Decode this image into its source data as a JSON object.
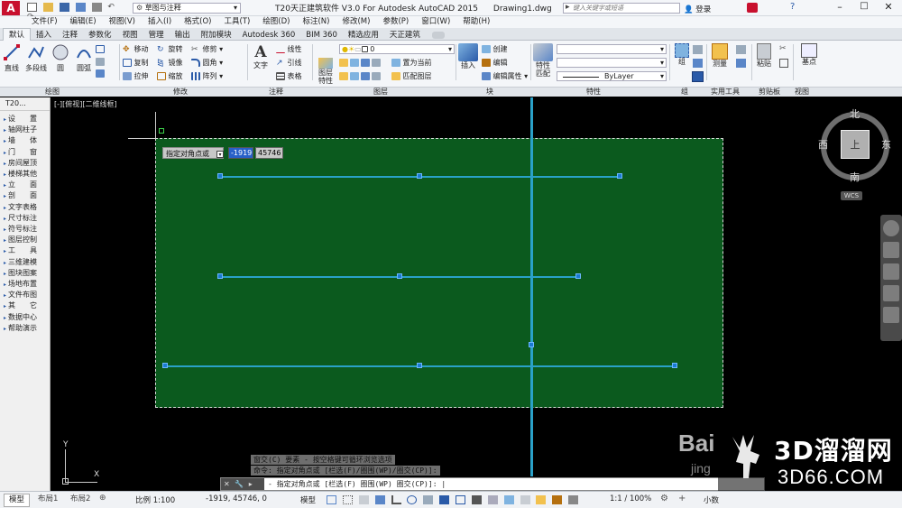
{
  "app": {
    "title": "T20天正建筑软件 V3.0 For Autodesk AutoCAD 2015",
    "filename": "Drawing1.dwg",
    "workspace": "草图与注释",
    "search_placeholder": "键入关键字或短语",
    "login_label": "登录"
  },
  "menu": [
    "文件(F)",
    "编辑(E)",
    "视图(V)",
    "插入(I)",
    "格式(O)",
    "工具(T)",
    "绘图(D)",
    "标注(N)",
    "修改(M)",
    "参数(P)",
    "窗口(W)",
    "帮助(H)"
  ],
  "tabs": [
    "默认",
    "插入",
    "注释",
    "参数化",
    "视图",
    "管理",
    "输出",
    "附加模块",
    "Autodesk 360",
    "BIM 360",
    "精选应用",
    "天正建筑"
  ],
  "ribbon": {
    "draw": {
      "line": "直线",
      "polyline": "多段线",
      "circle": "圆",
      "arc": "圆弧"
    },
    "modify": {
      "move": "移动",
      "rotate": "旋转",
      "trim": "修剪",
      "copy": "复制",
      "mirror": "镜像",
      "fillet": "圆角",
      "stretch": "拉伸",
      "scale": "缩放",
      "array": "阵列"
    },
    "annotation": {
      "text": "文字",
      "linear": "线性",
      "leader": "引线",
      "table": "表格"
    },
    "layers": {
      "layer_props": "图层\n特性",
      "layer_name": "0",
      "set_current": "置为当前",
      "match_layer": "匹配图层"
    },
    "block": {
      "insert": "插入",
      "create": "创建",
      "edit": "编辑",
      "edit_attr": "编辑属性"
    },
    "properties": {
      "match": "特性\n匹配",
      "bylayer": "ByLayer"
    },
    "groups": {
      "group": "组"
    },
    "utilities": {
      "measure": "测量"
    },
    "clipboard": {
      "paste": "粘贴"
    },
    "view": {
      "base": "基点"
    },
    "panel_titles": [
      "绘图",
      "修改",
      "注释",
      "图层",
      "块",
      "特性",
      "组",
      "实用工具",
      "剪贴板",
      "视图"
    ]
  },
  "tool_palette": {
    "title": "T20...",
    "items": [
      "设　　置",
      "轴网柱子",
      "墙　　体",
      "门　　窗",
      "房间屋顶",
      "楼梯其他",
      "立　　面",
      "剖　　面",
      "文字表格",
      "尺寸标注",
      "符号标注",
      "图层控制",
      "工　　具",
      "三维建模",
      "图块图案",
      "场地布置",
      "文件布图",
      "其　　它",
      "数据中心",
      "帮助演示"
    ]
  },
  "viewport": {
    "label": "[-][俯视][二维线框]",
    "dyn_prompt": "指定对角点或",
    "dyn_x": "-1919",
    "dyn_y": "45746",
    "compass": {
      "north": "北",
      "south": "南",
      "east": "东",
      "west": "西",
      "top": "上",
      "wcs": "WCS"
    },
    "ucs": {
      "x": "X",
      "y": "Y"
    }
  },
  "command": {
    "history1": "窗交(C) 要素 - 按空格键可循环浏览选项",
    "history2": "命令: 指定对角点或 [栏选(F)/圈围(WP)/圈交(CP)]:",
    "prompt": "- 指定对角点或 [栏选(F) 圈围(WP) 圈交(CP)]: |"
  },
  "status": {
    "tabs": [
      "模型",
      "布局1",
      "布局2"
    ],
    "scale": "比例 1:100",
    "coords": "-1919, 45746, 0",
    "model_label": "模型",
    "anno_scale": "1:1 / 100%",
    "decimal": "小数"
  },
  "watermark": {
    "brand": "3D溜溜网",
    "url": "3D66.COM",
    "baidu": "Bai",
    "jing": "jing"
  },
  "colors": {
    "selection_fill": "#0b5a1e",
    "line": "#2aa1c8",
    "grip": "#1a7bd1",
    "accent": "#c8102e"
  }
}
